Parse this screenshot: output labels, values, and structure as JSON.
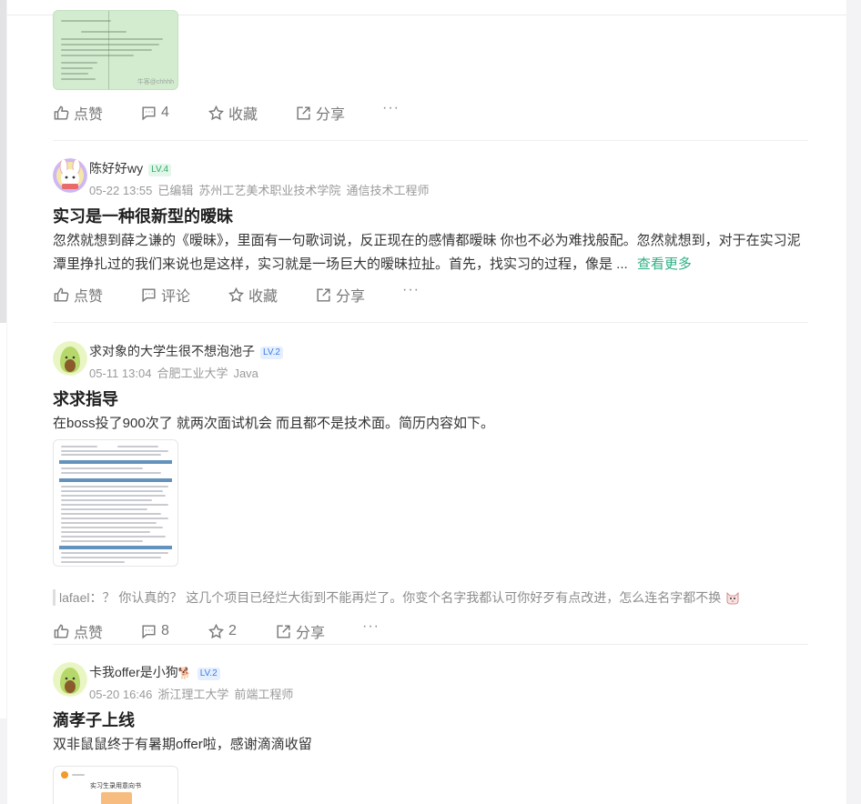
{
  "posts": [
    {
      "thumb_watermark": "牛客@chhhh",
      "actions": {
        "like": "点赞",
        "comment": "4",
        "favorite": "收藏",
        "share": "分享",
        "more": "···"
      }
    },
    {
      "user": "陈好好wy",
      "level": "LV.4",
      "meta": {
        "date": "05-22 13:55",
        "edited": "已编辑",
        "school": "苏州工艺美术职业技术学院",
        "role": "通信技术工程师"
      },
      "title": "实习是一种很新型的暧昧",
      "body": "忽然就想到薛之谦的《暧昧》，里面有一句歌词说，反正现在的感情都暧昧 你也不必为难找般配。忽然就想到，对于在实习泥潭里挣扎过的我们来说也是这样，实习就是一场巨大的暧昧拉扯。首先，找实习的过程，像是 ...",
      "more": "查看更多",
      "actions": {
        "like": "点赞",
        "comment": "评论",
        "favorite": "收藏",
        "share": "分享",
        "more": "···"
      }
    },
    {
      "user": "求对象的大学生很不想泡池子",
      "level": "LV.2",
      "meta": {
        "date": "05-11 13:04",
        "school": "合肥工业大学",
        "role": "Java"
      },
      "title": "求求指导",
      "body": "在boss投了900次了 就两次面试机会 而且都不是技术面。简历内容如下。",
      "comment": "lafael：？ 你认真的？ 这几个项目已经烂大街到不能再烂了。你变个名字我都认可你好歹有点改进，怎么连名字都不换",
      "actions": {
        "like": "点赞",
        "comment": "8",
        "favorite": "2",
        "share": "分享",
        "more": "···"
      }
    },
    {
      "user": "卡我offer是小狗",
      "user_emoji": "🐕",
      "level": "LV.2",
      "meta": {
        "date": "05-20 16:46",
        "school": "浙江理工大学",
        "role": "前端工程师"
      },
      "title": "滴孝子上线",
      "body": "双非鼠鼠终于有暑期offer啦，感谢滴滴收留",
      "thumb_title": "实习生录用意向书"
    }
  ],
  "icons": [
    "thumb-up-icon",
    "comment-icon",
    "star-icon",
    "share-icon",
    "more-icon"
  ],
  "colors": {
    "accent": "#2fb184",
    "level_green": "#2fa86a",
    "level_blue": "#3d7ee3"
  }
}
